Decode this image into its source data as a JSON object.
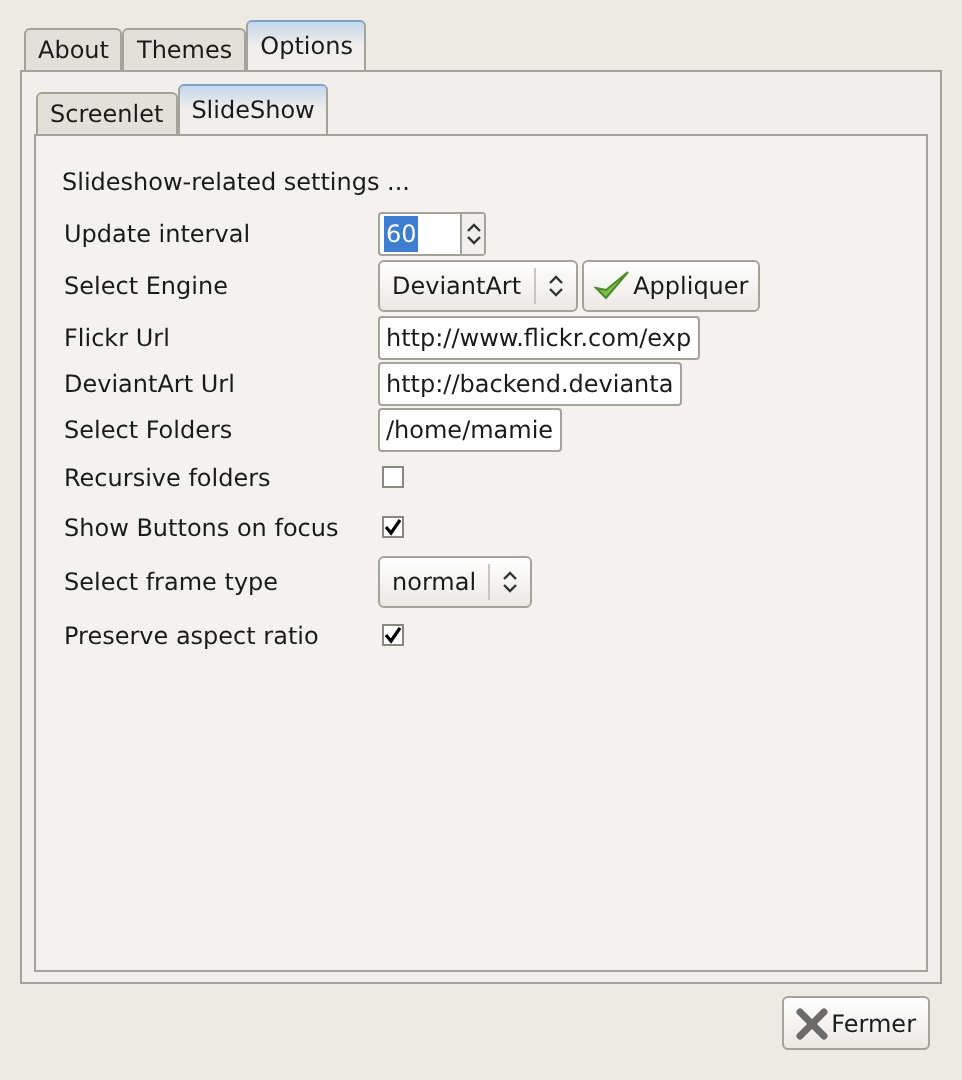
{
  "tabs": [
    {
      "label": "About",
      "selected": false
    },
    {
      "label": "Themes",
      "selected": false
    },
    {
      "label": "Options",
      "selected": true
    }
  ],
  "subtabs": [
    {
      "label": "Screenlet",
      "selected": false
    },
    {
      "label": "SlideShow",
      "selected": true
    }
  ],
  "heading": "Slideshow-related settings ...",
  "settings": [
    {
      "kind": "spin",
      "label": "Update interval",
      "value": "60"
    },
    {
      "kind": "combo",
      "label": "Select Engine",
      "value": "DeviantArt",
      "button": "Appliquer"
    },
    {
      "kind": "text",
      "label": "Flickr Url",
      "value": "http://www.flickr.com/exp"
    },
    {
      "kind": "text",
      "label": "DeviantArt Url",
      "value": "http://backend.devianta"
    },
    {
      "kind": "text",
      "label": "Select Folders",
      "value": "/home/mamie"
    },
    {
      "kind": "checkbox",
      "label": "Recursive folders",
      "checked": false
    },
    {
      "kind": "checkbox",
      "label": "Show Buttons on focus",
      "checked": true
    },
    {
      "kind": "combo",
      "label": "Select frame type",
      "value": "normal"
    },
    {
      "kind": "checkbox",
      "label": "Preserve aspect ratio",
      "checked": true
    }
  ],
  "close_button": "Fermer"
}
